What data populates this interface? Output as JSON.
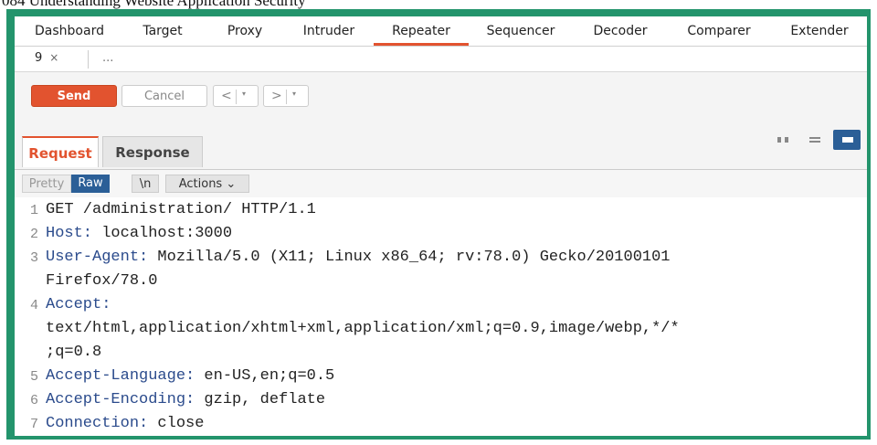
{
  "page_header": "084    Understanding Website Application Security",
  "top_tabs": [
    "Dashboard",
    "Target",
    "Proxy",
    "Intruder",
    "Repeater",
    "Sequencer",
    "Decoder",
    "Comparer",
    "Extender"
  ],
  "sub_tabs": {
    "tab_label": "9",
    "close": "×",
    "more": "..."
  },
  "toolbar": {
    "send": "Send",
    "cancel": "Cancel",
    "prev": "<",
    "next": ">",
    "dropdown": "▾"
  },
  "panel_tabs": {
    "request": "Request",
    "response": "Response"
  },
  "options": {
    "pretty": "Pretty",
    "raw": "Raw",
    "newline": "\\n",
    "actions": "Actions"
  },
  "icons": {
    "chevron": "chevron-down-icon",
    "layout_split": "split-view-icon",
    "layout_rows": "rows-view-icon",
    "layout_single": "single-view-icon"
  },
  "colors": {
    "accent": "#e2532f",
    "frame": "#23946c",
    "raw_active": "#2b5f97",
    "layout_active": "#2b5f97"
  },
  "request_lines": [
    {
      "num": "1",
      "key": "",
      "text": "GET /administration/ HTTP/1.1"
    },
    {
      "num": "2",
      "key": "Host:",
      "text": " localhost:3000"
    },
    {
      "num": "3",
      "key": "User-Agent:",
      "text": " Mozilla/5.0 (X11; Linux x86_64; rv:78.0) Gecko/20100101"
    },
    {
      "num": "",
      "key": "",
      "text": "Firefox/78.0"
    },
    {
      "num": "4",
      "key": "Accept:",
      "text": ""
    },
    {
      "num": "",
      "key": "",
      "text": "text/html,application/xhtml+xml,application/xml;q=0.9,image/webp,*/*"
    },
    {
      "num": "",
      "key": "",
      "text": ";q=0.8"
    },
    {
      "num": "5",
      "key": "Accept-Language:",
      "text": " en-US,en;q=0.5"
    },
    {
      "num": "6",
      "key": "Accept-Encoding:",
      "text": " gzip, deflate"
    },
    {
      "num": "7",
      "key": "Connection:",
      "text": " close"
    }
  ]
}
